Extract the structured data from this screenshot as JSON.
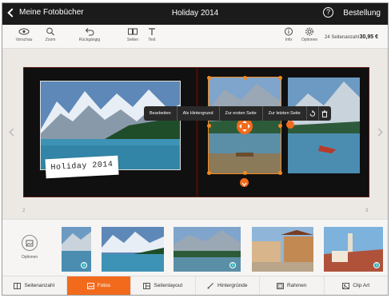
{
  "topbar": {
    "back_label": "Meine Fotobücher",
    "title": "Holiday 2014",
    "help_glyph": "?",
    "order_label": "Bestellung"
  },
  "toolbar": {
    "tools": [
      {
        "label": "Vorschau",
        "icon": "eye-icon"
      },
      {
        "label": "Zoom",
        "icon": "magnifier-icon"
      },
      {
        "label": "Rückgängig",
        "icon": "undo-icon"
      },
      {
        "label": "Seiten",
        "icon": "pages-icon"
      },
      {
        "label": "Text",
        "icon": "text-icon"
      },
      {
        "label": "Info",
        "icon": "info-icon"
      },
      {
        "label": "Optionen",
        "icon": "gear-icon"
      }
    ],
    "page_count": "24 Seitenanzahl",
    "price": "30,95 €"
  },
  "canvas": {
    "page_left": "2",
    "page_right": "3",
    "caption": "Holiday 2014"
  },
  "context_menu": {
    "items": [
      "Bearbeiten",
      "Als Hintergrund",
      "Zur ersten Seite",
      "Zur letzten Seite"
    ],
    "icons": [
      "rotate-icon",
      "trash-icon"
    ]
  },
  "strip": {
    "options_label": "Optionen",
    "badges": [
      "1",
      "1",
      "1"
    ]
  },
  "tabs": [
    {
      "label": "Seitenanzahl",
      "icon": "page-count-icon",
      "active": false
    },
    {
      "label": "Fotos",
      "icon": "photos-icon",
      "active": true
    },
    {
      "label": "Seitenlayout",
      "icon": "layout-icon",
      "active": false
    },
    {
      "label": "Hintergründe",
      "icon": "brush-icon",
      "active": false
    },
    {
      "label": "Rahmen",
      "icon": "frame-icon",
      "active": false
    },
    {
      "label": "Clip Art",
      "icon": "clipart-icon",
      "active": false
    }
  ],
  "colors": {
    "accent": "#f26b1d",
    "topbar": "#1b1b1b",
    "badge": "#2fb0b8"
  }
}
